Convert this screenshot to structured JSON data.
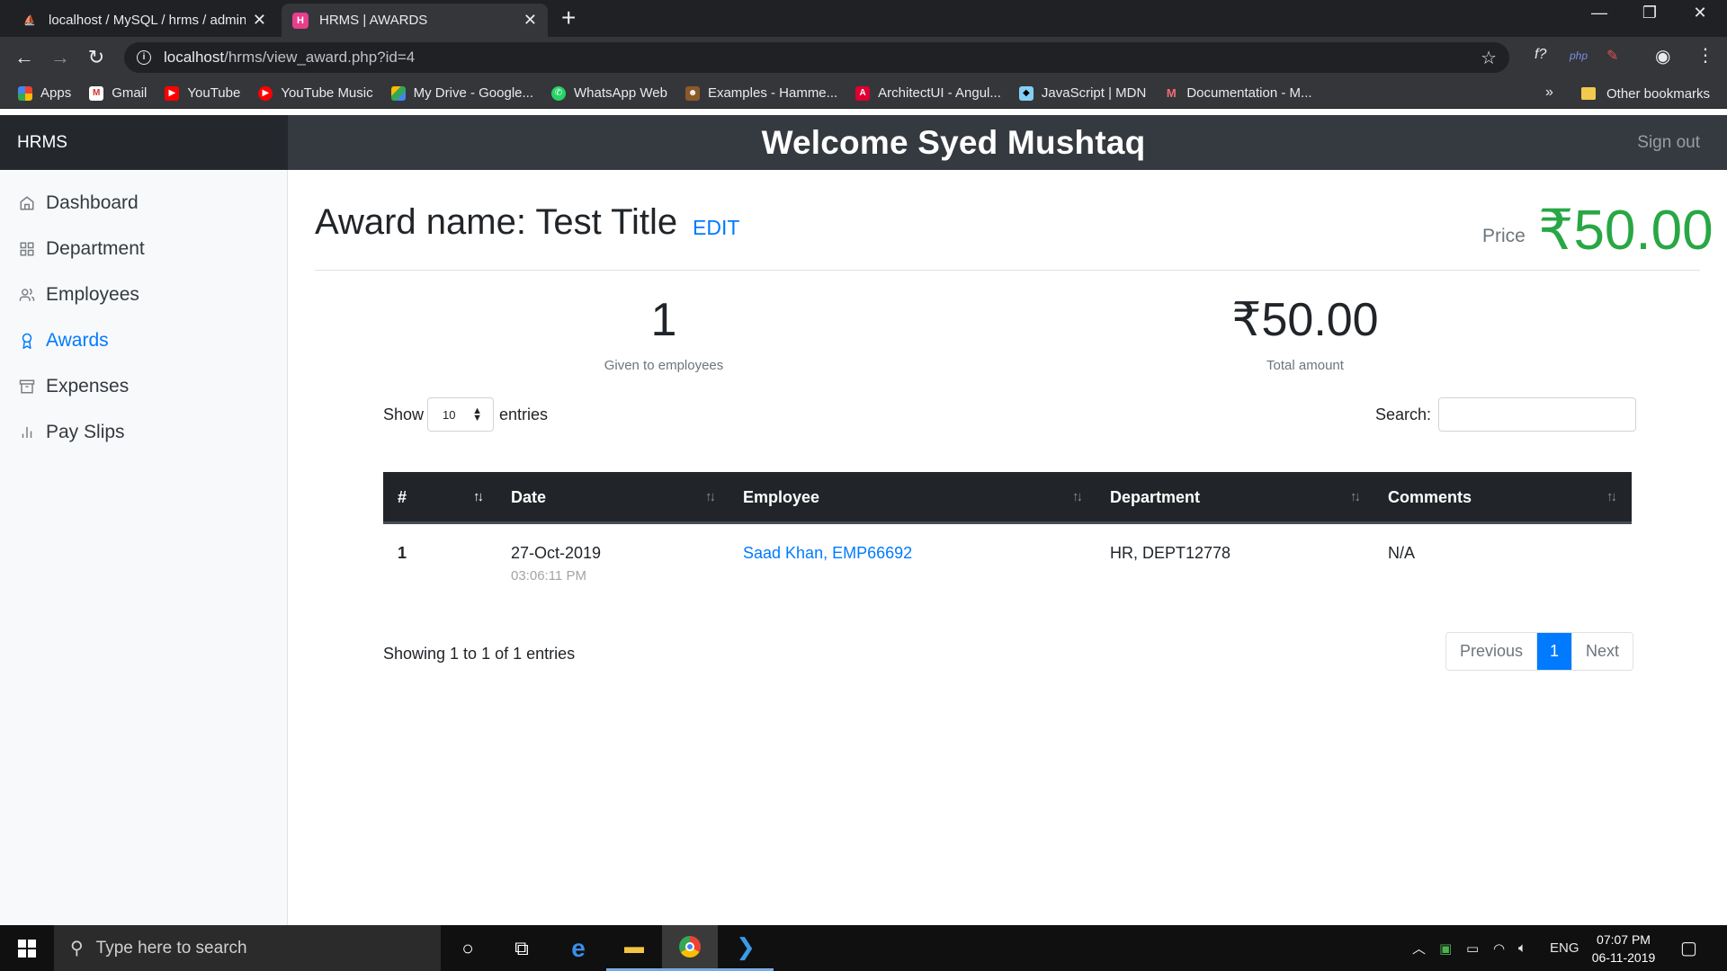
{
  "browser": {
    "tabs": [
      {
        "title": "localhost / MySQL / hrms / admin",
        "active": false
      },
      {
        "title": "HRMS | AWARDS",
        "active": true
      }
    ],
    "url_host": "localhost",
    "url_path": "/hrms/view_award.php?id=4",
    "bookmarks": [
      {
        "label": "Apps",
        "icon": "apps-grid-icon"
      },
      {
        "label": "Gmail",
        "icon": "gmail-icon"
      },
      {
        "label": "YouTube",
        "icon": "youtube-icon"
      },
      {
        "label": "YouTube Music",
        "icon": "youtube-music-icon"
      },
      {
        "label": "My Drive - Google...",
        "icon": "google-drive-icon"
      },
      {
        "label": "WhatsApp Web",
        "icon": "whatsapp-icon"
      },
      {
        "label": "Examples - Hamme...",
        "icon": "hammer-icon"
      },
      {
        "label": "ArchitectUI - Angul...",
        "icon": "angular-icon"
      },
      {
        "label": "JavaScript | MDN",
        "icon": "mdn-icon"
      },
      {
        "label": "Documentation - M...",
        "icon": "materialize-icon"
      }
    ],
    "bookmarks_more": "»",
    "other_bookmarks": "Other bookmarks"
  },
  "app": {
    "brand": "HRMS",
    "welcome": "Welcome Syed Mushtaq",
    "sign_out": "Sign out",
    "nav": [
      {
        "label": "Dashboard",
        "icon": "home-icon",
        "active": false
      },
      {
        "label": "Department",
        "icon": "grid-icon",
        "active": false
      },
      {
        "label": "Employees",
        "icon": "users-icon",
        "active": false
      },
      {
        "label": "Awards",
        "icon": "award-icon",
        "active": true
      },
      {
        "label": "Expenses",
        "icon": "archive-icon",
        "active": false
      },
      {
        "label": "Pay Slips",
        "icon": "bar-chart-icon",
        "active": false
      }
    ]
  },
  "award": {
    "title": "Award name: Test Title",
    "edit": "EDIT",
    "price_label": "Price",
    "price_value": "₹50.00"
  },
  "stats": {
    "given_count": "1",
    "given_label": "Given to employees",
    "total_amount": "₹50.00",
    "total_label": "Total amount"
  },
  "table": {
    "show_label": "Show",
    "entries_label": "entries",
    "page_length": "10",
    "search_label": "Search:",
    "search_value": "",
    "columns": [
      "#",
      "Date",
      "Employee",
      "Department",
      "Comments"
    ],
    "rows": [
      {
        "num": "1",
        "date": "27-Oct-2019",
        "time": "03:06:11 PM",
        "employee": "Saad Khan, EMP66692",
        "department": "HR, DEPT12778",
        "comments": "N/A"
      }
    ],
    "info": "Showing 1 to 1 of 1 entries",
    "pagination": {
      "previous": "Previous",
      "current": "1",
      "next": "Next"
    }
  },
  "taskbar": {
    "search_placeholder": "Type here to search",
    "language": "ENG",
    "time": "07:07 PM",
    "date": "06-11-2019"
  },
  "colors": {
    "accent": "#007bff",
    "price_green": "#28a745",
    "header_dark": "#343a40",
    "table_head": "#212529"
  }
}
